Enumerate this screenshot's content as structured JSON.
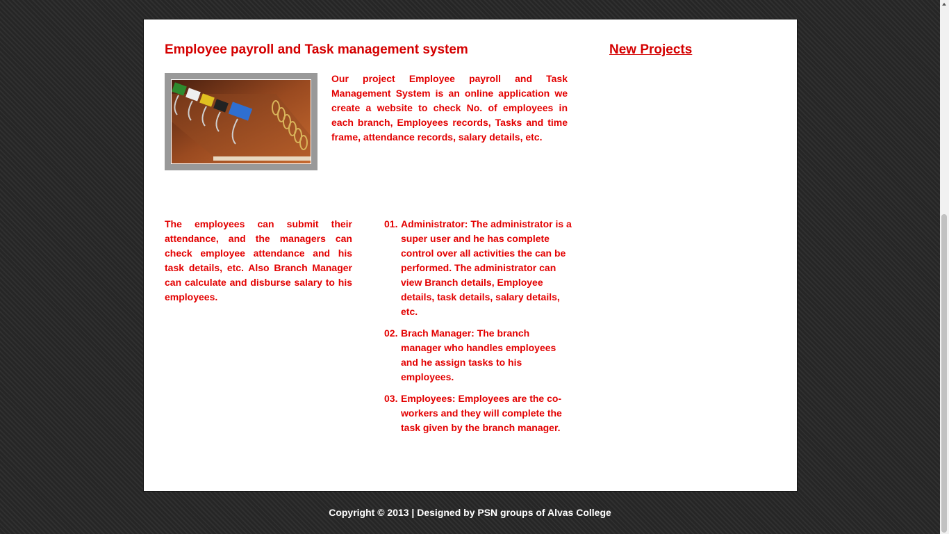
{
  "main": {
    "title": "Employee payroll and Task management system",
    "intro": "Our project Employee payroll and Task Management System is an online application we create a website to check No. of employees in each branch, Employees records, Tasks and time frame, attendance records, salary details, etc.",
    "left_paragraph": "The employees can submit their attendance, and the managers can check employee attendance and his task details, etc. Also Branch Manager can calculate and disburse salary to his employees.",
    "roles": [
      {
        "num": "01.",
        "text": "Administrator:  The administrator is a super user and he has complete control over all activities the can be performed. The administrator can view Branch details, Employee details, task details, salary details, etc."
      },
      {
        "num": "02.",
        "text": "Brach Manager: The branch manager who handles employees and he assign tasks to his employees."
      },
      {
        "num": "03.",
        "text": "Employees: Employees are the co-workers and they will complete the task given by the branch manager."
      }
    ]
  },
  "sidebar": {
    "title": "New Projects"
  },
  "footer": {
    "text": "Copyright © 2013 | Designed by PSN groups of Alvas College"
  },
  "colors": {
    "accent": "#d40000",
    "body_text": "#e30000",
    "page_bg": "#ffffff",
    "outer_bg": "#2b2b2b"
  }
}
